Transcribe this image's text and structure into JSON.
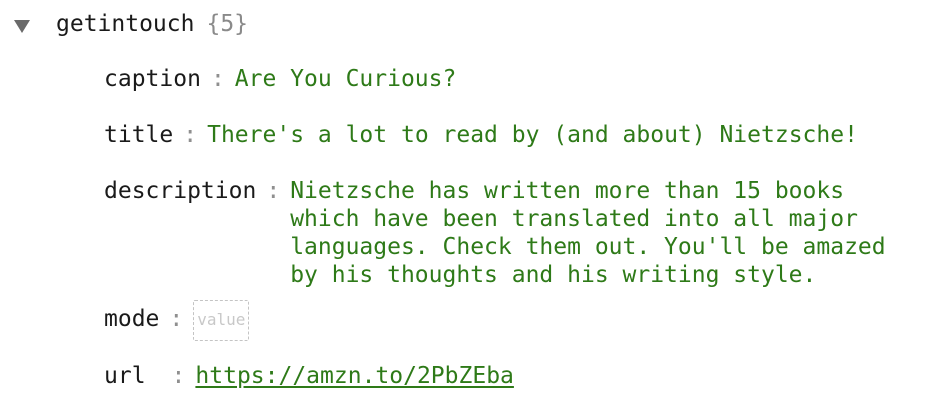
{
  "node": {
    "key": "getintouch",
    "count": "{5}"
  },
  "fields": {
    "caption": {
      "key": "caption",
      "sep": ":",
      "value": "Are You Curious?"
    },
    "title": {
      "key": "title",
      "sep": ":",
      "value": "There's a lot to read by (and about) Nietzsche!"
    },
    "description": {
      "key": "description",
      "sep": ":",
      "lines": [
        "Nietzsche has written more than 15 books",
        "which have been translated into all major",
        "languages. Check them out. You'll be amazed",
        "by his thoughts and his writing style."
      ]
    },
    "mode": {
      "key": "mode",
      "sep": ":",
      "placeholder": "value"
    },
    "url": {
      "key": "url",
      "sep": ":",
      "value": "https://amzn.to/2PbZEba"
    }
  },
  "icons": {
    "toggle": "caret-down-icon"
  },
  "colors": {
    "key": "#1a1a1a",
    "value": "#2e7a18",
    "separator": "#8f8f8f",
    "count": "#8a8a8a",
    "placeholder": "#c8c8c8"
  }
}
